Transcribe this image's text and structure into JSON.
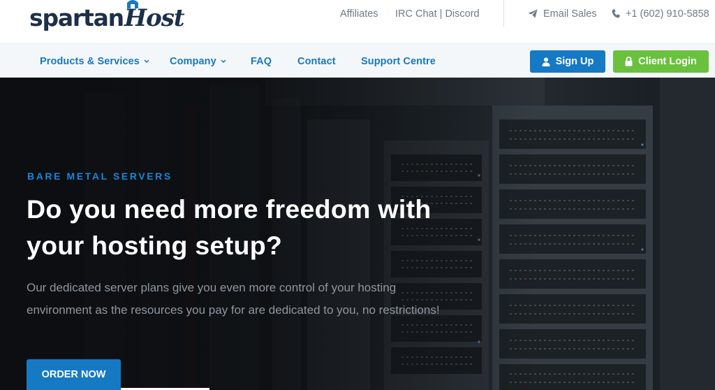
{
  "brand": {
    "logo_part1": "spartan",
    "logo_part2": "Host"
  },
  "topbar": {
    "affiliates": "Affiliates",
    "irc_chat": "IRC Chat | Discord",
    "email_sales": "Email Sales",
    "phone": "+1 (602) 910-5858",
    "icons": {
      "email": "paper-plane-icon",
      "phone": "phone-icon"
    }
  },
  "nav": {
    "items": [
      {
        "label": "Products & Services",
        "dropdown": true
      },
      {
        "label": "Company",
        "dropdown": true
      },
      {
        "label": "FAQ",
        "dropdown": false
      },
      {
        "label": "Contact",
        "dropdown": false
      },
      {
        "label": "Support Centre",
        "dropdown": false
      }
    ],
    "signup_label": "Sign Up",
    "login_label": "Client Login"
  },
  "hero": {
    "eyebrow": "BARE METAL SERVERS",
    "headline": "Do you need more freedom with your hosting setup?",
    "subtext": "Our dedicated server plans give you even more control of your hosting environment as the resources you pay for are dedicated to you, no restrictions!",
    "cta_label": "ORDER NOW"
  },
  "colors": {
    "brand_blue": "#1679c3",
    "login_green": "#6ac13e",
    "logo_navy": "#1d2f4a",
    "nav_bg": "#f4f7fa"
  }
}
